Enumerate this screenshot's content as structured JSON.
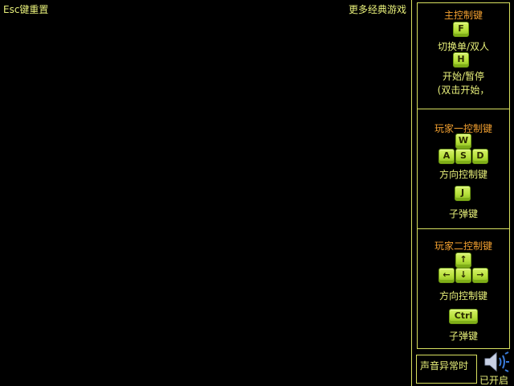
{
  "header": {
    "reset_label": "Esc键重置",
    "more_games_label": "更多经典游戏"
  },
  "main_controls": {
    "title": "主控制键",
    "key_toggle": "F",
    "toggle_label": "切换单/双人",
    "key_start": "H",
    "start_label": "开始/暂停",
    "start_hint": "(双击开始，"
  },
  "player1": {
    "title": "玩家一控制键",
    "key_up": "W",
    "key_left": "A",
    "key_down": "S",
    "key_right": "D",
    "direction_label": "方向控制键",
    "key_fire": "J",
    "fire_label": "子弹键"
  },
  "player2": {
    "title": "玩家二控制键",
    "key_up": "↑",
    "key_left": "←",
    "key_down": "↓",
    "key_right": "→",
    "direction_label": "方向控制键",
    "key_fire": "Ctrl",
    "fire_label": "子弹键"
  },
  "sound": {
    "abnormal_label": "声音异常时",
    "icon": "speaker-icon",
    "state_label": "已开启"
  },
  "colors": {
    "background": "#000000",
    "text": "#e8f07a",
    "title": "#f2a030",
    "key": "#b6e03a"
  }
}
